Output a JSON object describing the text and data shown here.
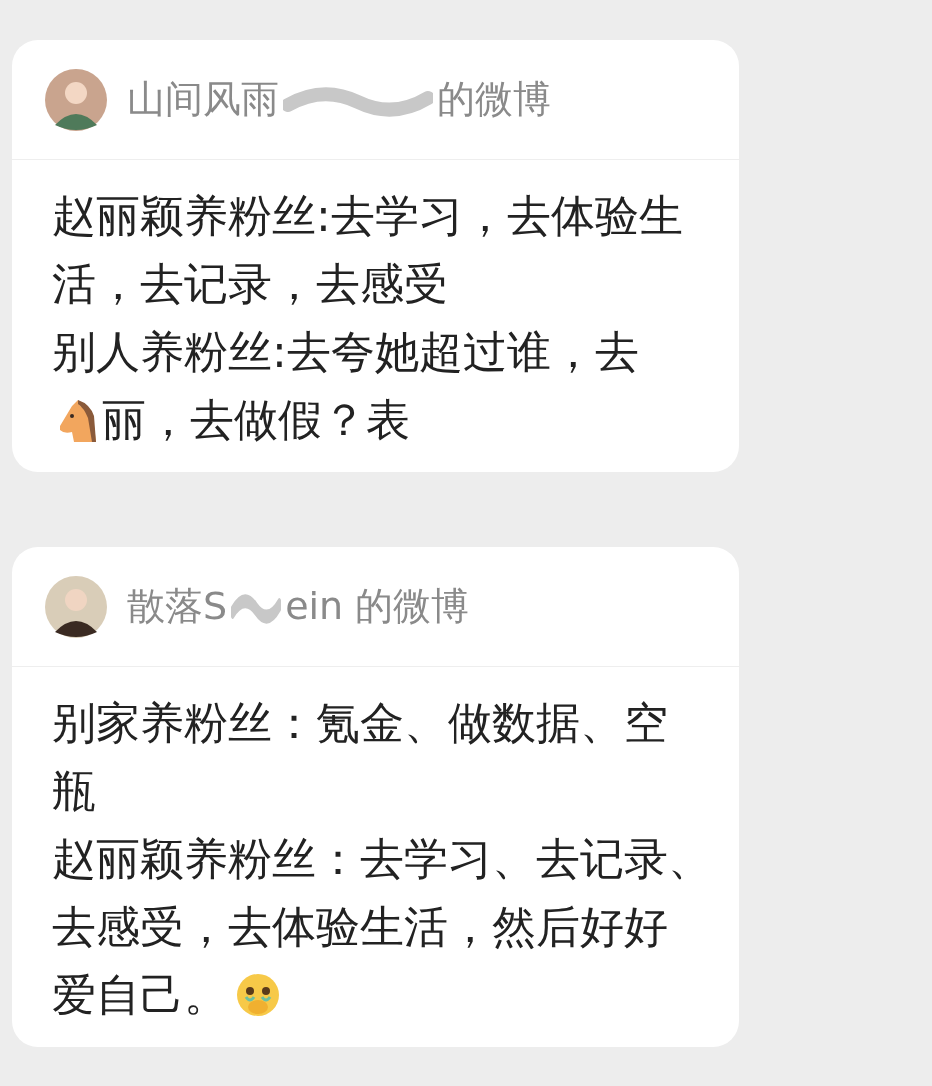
{
  "messages": [
    {
      "card": {
        "source_start": "山间风雨",
        "source_end": "的微博",
        "lines": [
          [
            {
              "kind": "text",
              "text": "赵丽颖养粉丝:去学习，去体验生"
            }
          ],
          [
            {
              "kind": "text",
              "text": "活，去记录，去感受"
            }
          ],
          [
            {
              "kind": "text",
              "text": "别人养粉丝:去夸她超过谁，去"
            }
          ],
          [
            {
              "kind": "horse"
            },
            {
              "kind": "text",
              "text": "丽，去做假？表"
            }
          ]
        ]
      }
    },
    {
      "card": {
        "source_start": "散落S",
        "source_end": "ein 的微博",
        "lines": [
          [
            {
              "kind": "text",
              "text": "别家养粉丝：氪金、做数据、空"
            }
          ],
          [
            {
              "kind": "text",
              "text": "瓶"
            }
          ],
          [
            {
              "kind": "text",
              "text": "赵丽颖养粉丝：去学习、去记录、"
            }
          ],
          [
            {
              "kind": "text",
              "text": "去感受，去体验生活，然后好好"
            }
          ],
          [
            {
              "kind": "text",
              "text": "爱自己。"
            },
            {
              "kind": "crying"
            }
          ]
        ]
      }
    }
  ]
}
